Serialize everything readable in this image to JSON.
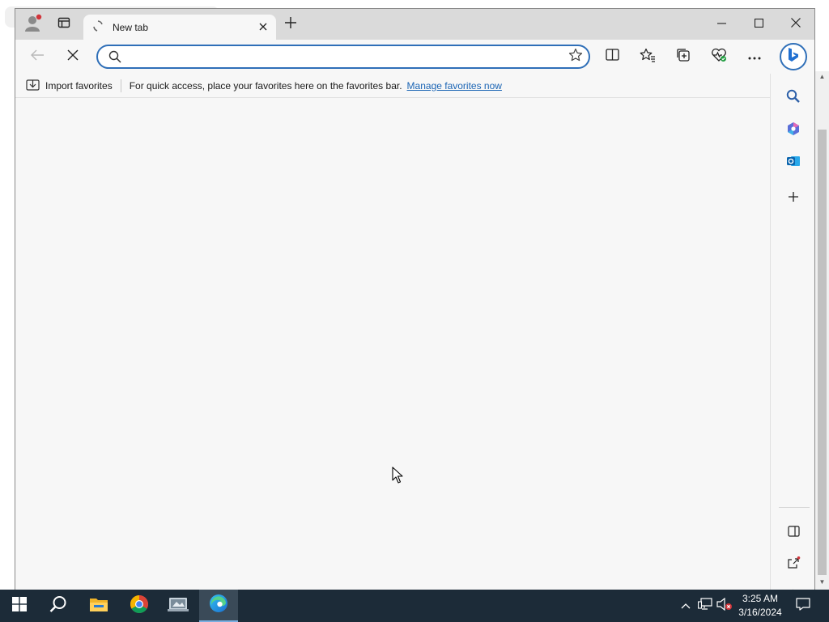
{
  "tab": {
    "title": "New tab"
  },
  "addressbar": {
    "placeholder": ""
  },
  "favorites_bar": {
    "import_label": "Import favorites",
    "message": "For quick access, place your favorites here on the favorites bar.",
    "manage_link": "Manage favorites now"
  },
  "taskbar": {
    "time": "3:25 AM",
    "date": "3/16/2024"
  },
  "colors": {
    "accent": "#2f6fb8",
    "link": "#1a64b4",
    "taskbar": "#1c2b38",
    "window_bg": "#f7f7f7"
  },
  "icons": {
    "window": [
      "profile-icon",
      "tab-actions-icon",
      "loading-icon",
      "close-icon",
      "plus-icon",
      "minimize-icon",
      "maximize-icon"
    ],
    "toolbar": [
      "back-icon",
      "stop-icon",
      "search-icon",
      "star-icon",
      "split-screen-icon",
      "favorites-icon",
      "collections-icon",
      "browser-essentials-icon",
      "more-icon",
      "bing-chat-icon"
    ],
    "sidebar": [
      "search-icon",
      "copilot-icon",
      "outlook-icon",
      "plus-icon",
      "sidebar-toggle-icon",
      "open-external-icon",
      "settings-icon"
    ],
    "taskbar": [
      "windows-start-icon",
      "search-icon",
      "file-explorer-icon",
      "chrome-icon",
      "app-icon",
      "edge-icon",
      "chevron-up-icon",
      "network-icon",
      "volume-muted-icon",
      "notifications-icon"
    ]
  }
}
